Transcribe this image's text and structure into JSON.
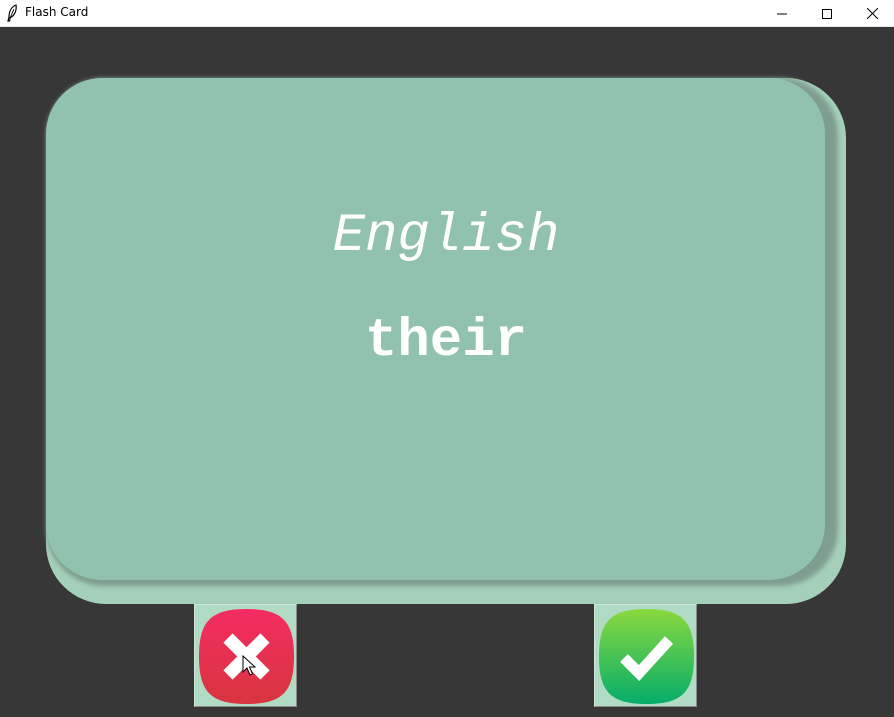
{
  "window": {
    "title": "Flash Card",
    "controls": [
      "minimize",
      "maximize",
      "close"
    ]
  },
  "card": {
    "language": "English",
    "word": "their",
    "front_color": "#91c2ad",
    "back_color": "#a4cfb9"
  },
  "buttons": {
    "wrong": {
      "icon": "x-mark-icon",
      "color": "#e8304f"
    },
    "right": {
      "icon": "check-mark-icon",
      "color": "#28c35a"
    }
  },
  "colors": {
    "background": "#373737",
    "button_face": "#b1dbc4"
  }
}
